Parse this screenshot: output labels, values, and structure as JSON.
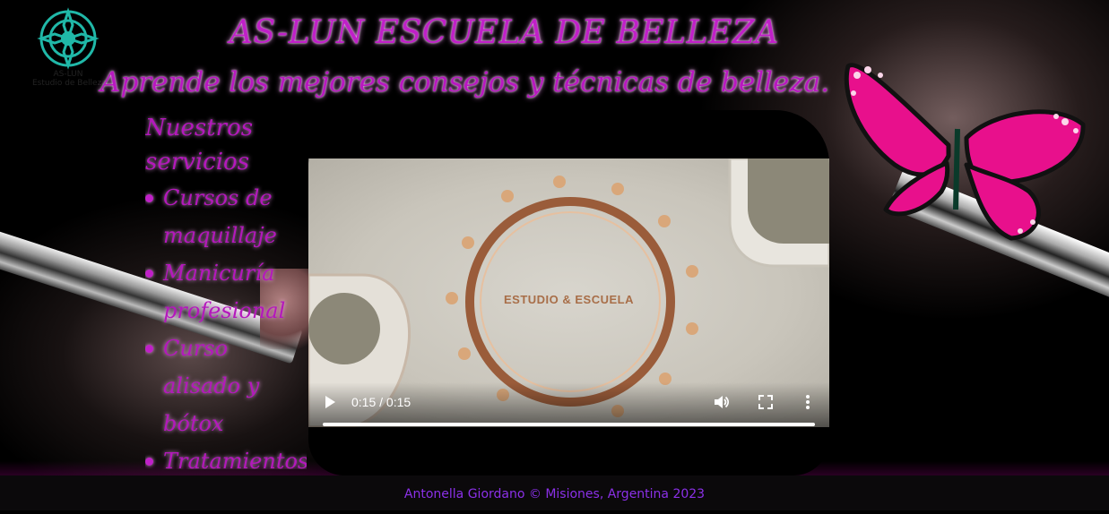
{
  "site": {
    "title": "AS-LUN ESCUELA DE BELLEZA",
    "tagline": "Aprende los mejores consejos y técnicas de belleza.",
    "logo": {
      "name": "AS-LUN",
      "subtitle": "Estudio de Belleza",
      "icon": "mandala-logo-icon"
    }
  },
  "services": {
    "heading": "Nuestros servicios",
    "items": [
      {
        "label": "Cursos de maquillaje"
      },
      {
        "label": "Manicuría profesional"
      },
      {
        "label": "Curso alisado y bótox"
      },
      {
        "label": "Tratamientos faciales"
      }
    ]
  },
  "video": {
    "brand_text": "ESTUDIO & ESCUELA",
    "time_display": "0:15 / 0:15",
    "progress": 1.0,
    "controls": {
      "play": "play-icon",
      "volume": "volume-icon",
      "fullscreen": "fullscreen-icon",
      "more": "more-options-icon"
    }
  },
  "footer": {
    "text": "Antonella Giordano © Misiones, Argentina 2023"
  },
  "colors": {
    "accent": "#c020c8",
    "footer_text": "#8b30e8",
    "footer_bg": "#0b090b",
    "logo_teal": "#20b8a8",
    "butterfly_pink": "#e8108c"
  }
}
